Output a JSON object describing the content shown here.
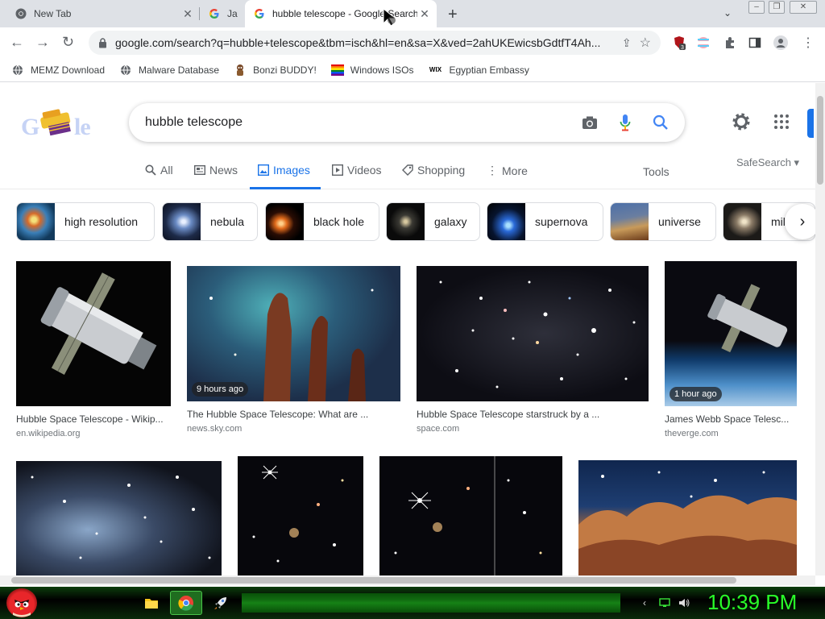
{
  "window": {
    "tabs": [
      {
        "title": "New Tab",
        "icon": "chrome-icon"
      },
      {
        "title": "Ja",
        "icon": "google-g-icon"
      },
      {
        "title": "hubble telescope - Google Search",
        "icon": "google-g-icon",
        "active": true
      }
    ],
    "controls": {
      "minimize": "minimize-icon",
      "restore": "restore-icon",
      "close": "close-icon"
    }
  },
  "toolbar": {
    "url": "google.com/search?q=hubble+telescope&tbm=isch&hl=en&sa=X&ved=2ahUKEwicsbGdtfT4Ah...",
    "extension_badge": "3"
  },
  "bookmarks": [
    {
      "label": "MEMZ Download",
      "icon": "globe-icon"
    },
    {
      "label": "Malware Database",
      "icon": "globe-icon"
    },
    {
      "label": "Bonzi BUDDY!",
      "icon": "bonzi-icon"
    },
    {
      "label": "Windows ISOs",
      "icon": "rainbow-flag-icon"
    },
    {
      "label": "Egyptian Embassy",
      "icon": "wix-icon"
    }
  ],
  "search": {
    "logo": "Google",
    "query": "hubble telescope",
    "tabs": [
      {
        "label": "All",
        "icon": "search-icon"
      },
      {
        "label": "News",
        "icon": "news-icon"
      },
      {
        "label": "Images",
        "icon": "image-icon",
        "active": true
      },
      {
        "label": "Videos",
        "icon": "video-icon"
      },
      {
        "label": "Shopping",
        "icon": "tag-icon"
      },
      {
        "label": "More",
        "icon": "more-vert-icon"
      }
    ],
    "tools": "Tools",
    "safesearch": "SafeSearch"
  },
  "chips": [
    {
      "label": "high resolution"
    },
    {
      "label": "nebula"
    },
    {
      "label": "black hole"
    },
    {
      "label": "galaxy"
    },
    {
      "label": "supernova"
    },
    {
      "label": "universe"
    },
    {
      "label": "mil"
    }
  ],
  "results": [
    {
      "title": "Hubble Space Telescope - Wikip...",
      "source": "en.wikipedia.org",
      "badge": ""
    },
    {
      "title": "The Hubble Space Telescope: What are ...",
      "source": "news.sky.com",
      "badge": "9 hours ago"
    },
    {
      "title": "Hubble Space Telescope starstruck by a ...",
      "source": "space.com",
      "badge": ""
    },
    {
      "title": "James Webb Space Telesc...",
      "source": "theverge.com",
      "badge": "1 hour ago"
    },
    {
      "title": "",
      "source": "",
      "badge": ""
    },
    {
      "title": "",
      "source": "",
      "badge": ""
    },
    {
      "title": "",
      "source": "",
      "badge": ""
    },
    {
      "title": "",
      "source": "",
      "badge": ""
    }
  ],
  "taskbar": {
    "clock": "10:39 PM",
    "apps": [
      "folder-icon",
      "chrome-icon",
      "rocket-icon"
    ]
  },
  "colors": {
    "accent": "#1a73e8",
    "taskbar_green": "#29ff29",
    "tab_strip": "#dee1e6"
  }
}
